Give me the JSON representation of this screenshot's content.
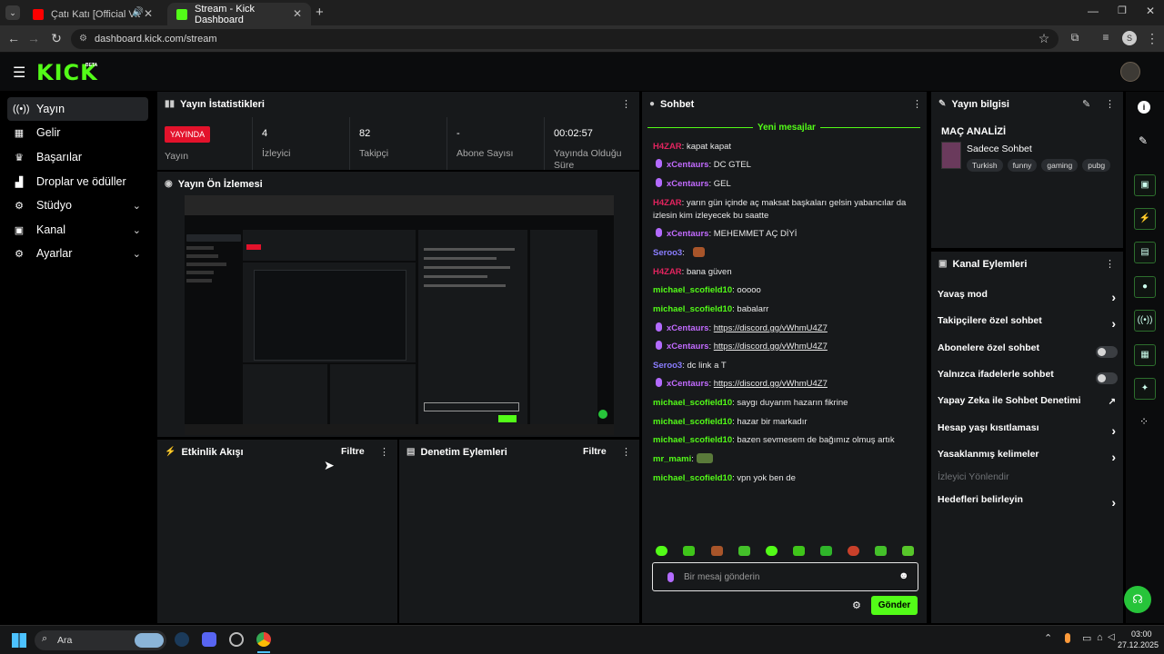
{
  "browser": {
    "tabs": [
      {
        "title": "Çatı Katı [Official Video] - G",
        "active": false
      },
      {
        "title": "Stream - Kick Dashboard",
        "active": true
      }
    ],
    "url": "dashboard.kick.com/stream"
  },
  "app": {
    "logo": "KICK",
    "logo_badge": "BETA"
  },
  "sidebar": {
    "items": [
      {
        "label": "Yayın",
        "icon": "broadcast-icon",
        "active": true,
        "expandable": false
      },
      {
        "label": "Gelir",
        "icon": "revenue-icon",
        "active": false,
        "expandable": false
      },
      {
        "label": "Başarılar",
        "icon": "trophy-icon",
        "active": false,
        "expandable": false
      },
      {
        "label": "Droplar ve ödüller",
        "icon": "gift-icon",
        "active": false,
        "expandable": false
      },
      {
        "label": "Stüdyo",
        "icon": "studio-icon",
        "active": false,
        "expandable": true
      },
      {
        "label": "Kanal",
        "icon": "channel-icon",
        "active": false,
        "expandable": true
      },
      {
        "label": "Ayarlar",
        "icon": "settings-icon",
        "active": false,
        "expandable": true
      }
    ]
  },
  "stats": {
    "title": "Yayın İstatistikleri",
    "live_badge": "YAYINDA",
    "live_label": "Yayın",
    "cells": [
      {
        "value": "4",
        "label": "İzleyici"
      },
      {
        "value": "82",
        "label": "Takipçi"
      },
      {
        "value": "-",
        "label": "Abone Sayısı"
      },
      {
        "value": "00:02:57",
        "label": "Yayında Olduğu Süre"
      }
    ]
  },
  "preview": {
    "title": "Yayın Ön İzlemesi"
  },
  "activity": {
    "title": "Etkinlik Akışı",
    "filter": "Filtre"
  },
  "moderation": {
    "title": "Denetim Eylemleri",
    "filter": "Filtre"
  },
  "chat": {
    "title": "Sohbet",
    "new_messages": "Yeni mesajlar",
    "messages": [
      {
        "user": "H4ZAR",
        "color": "#e0245e",
        "mic": false,
        "text": "kapat kapat",
        "link": ""
      },
      {
        "user": "xCentaurs",
        "color": "#c26bff",
        "mic": true,
        "text": "DC GTEL",
        "link": ""
      },
      {
        "user": "xCentaurs",
        "color": "#c26bff",
        "mic": true,
        "text": "GEL",
        "link": ""
      },
      {
        "user": "H4ZAR",
        "color": "#e0245e",
        "mic": false,
        "text": "yarın gün içinde aç maksat başkaları gelsin yabancılar da izlesin kim izleyecek bu saatte",
        "link": ""
      },
      {
        "user": "xCentaurs",
        "color": "#c26bff",
        "mic": true,
        "text": "MEHEMMET AÇ DİYİ",
        "link": ""
      },
      {
        "user": "Seroo3",
        "color": "#8a7dff",
        "mic": false,
        "text": "",
        "link": ""
      },
      {
        "user": "H4ZAR",
        "color": "#e0245e",
        "mic": false,
        "text": "bana güven",
        "link": ""
      },
      {
        "user": "michael_scofield10",
        "color": "#53fc18",
        "mic": false,
        "text": "ooooo",
        "link": ""
      },
      {
        "user": "michael_scofield10",
        "color": "#53fc18",
        "mic": false,
        "text": "babalarr",
        "link": ""
      },
      {
        "user": "xCentaurs",
        "color": "#c26bff",
        "mic": true,
        "text": "",
        "link": "https://discord.gg/vWhmU4Z7"
      },
      {
        "user": "xCentaurs",
        "color": "#c26bff",
        "mic": true,
        "text": "",
        "link": "https://discord.gg/vWhmU4Z7"
      },
      {
        "user": "Seroo3",
        "color": "#8a7dff",
        "mic": false,
        "text": "dc link a T",
        "link": ""
      },
      {
        "user": "xCentaurs",
        "color": "#c26bff",
        "mic": true,
        "text": "",
        "link": "https://discord.gg/vWhmU4Z7"
      },
      {
        "user": "michael_scofield10",
        "color": "#53fc18",
        "mic": false,
        "text": "saygı duyarım hazarın fikrine",
        "link": ""
      },
      {
        "user": "michael_scofield10",
        "color": "#53fc18",
        "mic": false,
        "text": "hazar bir markadır",
        "link": ""
      },
      {
        "user": "michael_scofield10",
        "color": "#53fc18",
        "mic": false,
        "text": "bazen sevmesem de bağımız olmuş artık",
        "link": ""
      },
      {
        "user": "mr_mami",
        "color": "#53fc18",
        "mic": false,
        "text": "",
        "link": ""
      },
      {
        "user": "michael_scofield10",
        "color": "#53fc18",
        "mic": false,
        "text": "vpn yok ben de",
        "link": ""
      }
    ],
    "input_placeholder": "Bir mesaj gönderin",
    "send_label": "Gönder"
  },
  "stream_info": {
    "title": "Yayın bilgisi",
    "stream_title": "MAÇ ANALİZİ",
    "category": "Sadece Sohbet",
    "tags": [
      "Turkish",
      "funny",
      "gaming",
      "pubg"
    ]
  },
  "channel_actions": {
    "title": "Kanal Eylemleri",
    "items": [
      {
        "label": "Yavaş mod",
        "control": "arrow"
      },
      {
        "label": "Takipçilere özel sohbet",
        "control": "arrow"
      },
      {
        "label": "Abonelere özel sohbet",
        "control": "toggle"
      },
      {
        "label": "Yalnızca ifadelerle sohbet",
        "control": "toggle"
      },
      {
        "label": "Yapay Zeka ile Sohbet Denetimi",
        "control": "external"
      },
      {
        "label": "Hesap yaşı kısıtlaması",
        "control": "arrow"
      },
      {
        "label": "Yasaklanmış kelimeler",
        "control": "arrow"
      },
      {
        "label": "İzleyici Yönlendir",
        "control": "disabled"
      },
      {
        "label": "Hedefleri belirleyin",
        "control": "arrow"
      }
    ]
  },
  "taskbar": {
    "search": "Ara",
    "time": "03:00",
    "date": "27.12.2025"
  },
  "colors": {
    "accent": "#53fc18",
    "live": "#e3122b",
    "panel": "#17191b"
  }
}
